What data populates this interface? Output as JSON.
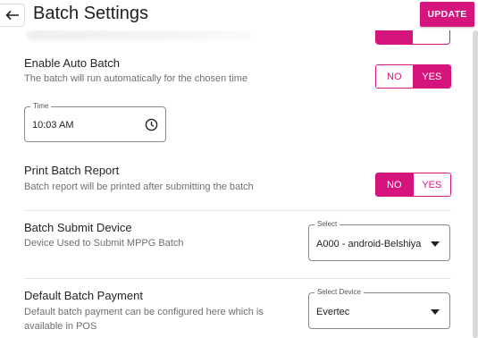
{
  "header": {
    "title": "Batch Settings",
    "back_icon": "arrow-left-icon",
    "update_label": "UPDATE"
  },
  "colors": {
    "accent": "#d6147d",
    "text": "#262626",
    "subtext": "#6f6f6f",
    "divider": "#e3e3e3"
  },
  "settings": {
    "auto_batch": {
      "title": "Enable Auto Batch",
      "description": "The batch will run automatically for the chosen time",
      "no_label": "NO",
      "yes_label": "YES",
      "selected": "YES"
    },
    "time": {
      "label": "Time",
      "value": "10:03 AM",
      "icon": "clock-icon"
    },
    "print_report": {
      "title": "Print Batch Report",
      "description": "Batch report will be printed after submitting the batch",
      "no_label": "NO",
      "yes_label": "YES",
      "selected": "NO"
    },
    "submit_device": {
      "title": "Batch Submit Device",
      "description": "Device Used to Submit MPPG Batch",
      "select_label": "Select",
      "selected_value": "A000 - android-Belshiya"
    },
    "default_payment": {
      "title": "Default Batch Payment",
      "description_line1": "Default batch payment can be configured here which is",
      "description_line2": "available in POS",
      "select_label": "Select Device",
      "selected_value": "Evertec"
    }
  }
}
